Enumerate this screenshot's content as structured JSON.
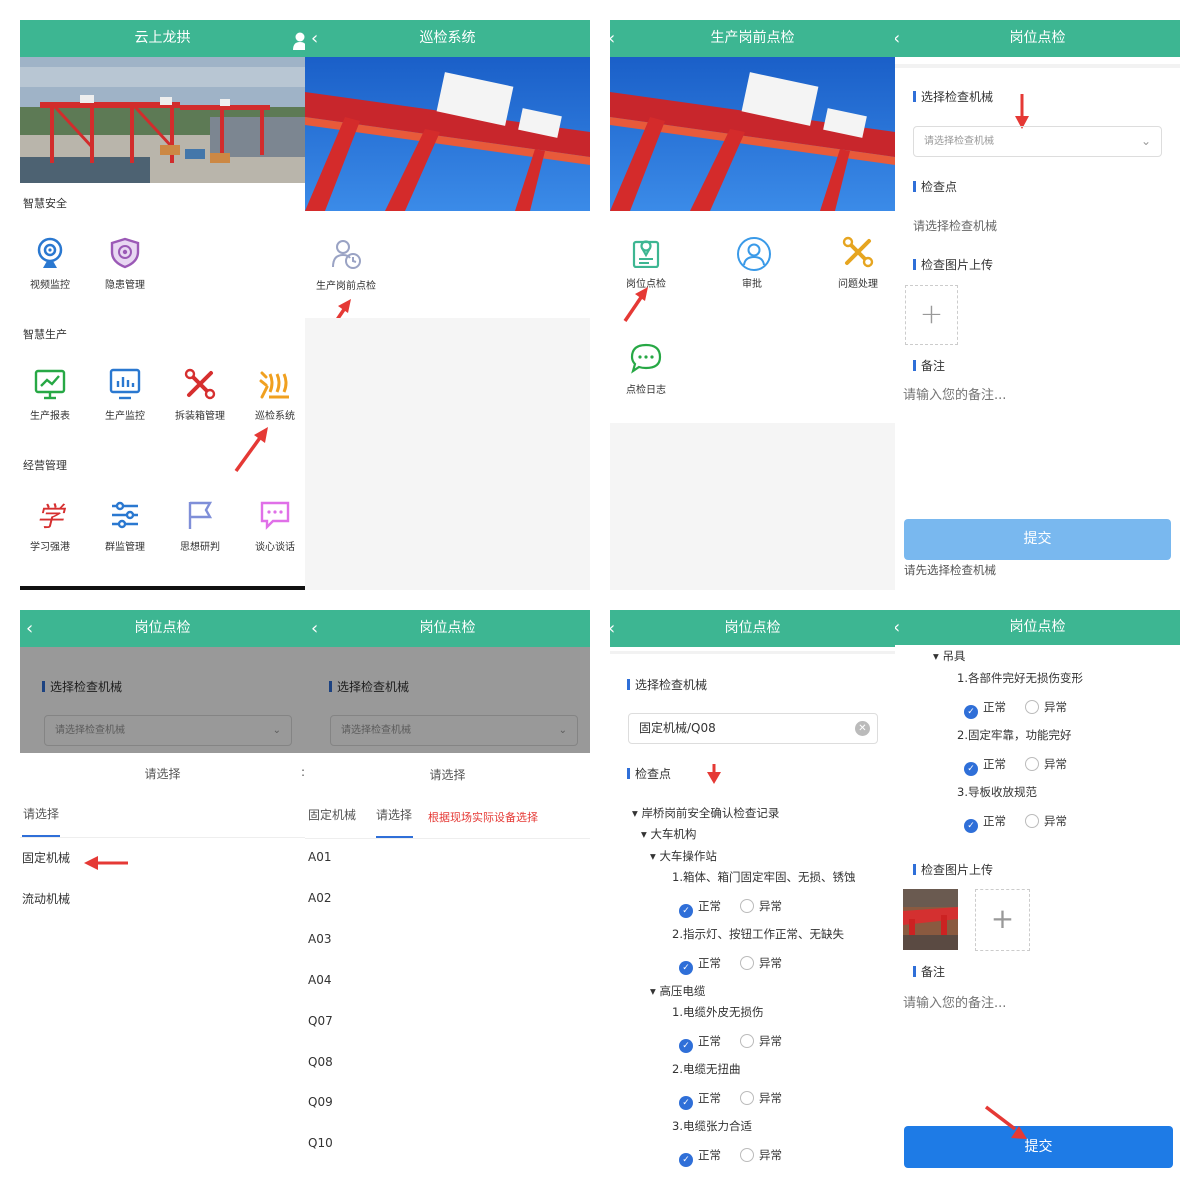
{
  "p1": {
    "title": "云上龙拱",
    "sections": [
      "智慧安全",
      "智慧生产",
      "经营管理"
    ],
    "safety": [
      "视频监控",
      "隐患管理"
    ],
    "production": [
      "生产报表",
      "生产监控",
      "拆装箱管理",
      "巡检系统"
    ],
    "management": [
      "学习强港",
      "群监管理",
      "思想研判",
      "谈心谈话"
    ]
  },
  "p2": {
    "title": "巡检系统",
    "item": "生产岗前点检"
  },
  "p3": {
    "title": "生产岗前点检",
    "items": [
      "岗位点检",
      "审批",
      "问题处理",
      "点检日志"
    ]
  },
  "p4": {
    "title": "岗位点检",
    "select_label": "选择检查机械",
    "select_placeholder": "请选择检查机械",
    "point_label": "检查点",
    "point_hint": "请选择检查机械",
    "photo_label": "检查图片上传",
    "remark_label": "备注",
    "remark_placeholder": "请输入您的备注...",
    "submit": "提交",
    "warning": "请先选择检查机械"
  },
  "p5": {
    "title": "岗位点检",
    "select_label": "选择检查机械",
    "select_placeholder": "请选择检查机械",
    "picker_title": "请选择",
    "tab": "请选择",
    "options": [
      "固定机械",
      "流动机械"
    ]
  },
  "p6": {
    "title": "岗位点检",
    "select_label": "选择检查机械",
    "select_placeholder": "请选择检查机械",
    "picker_title": "请选择",
    "tab1": "固定机械",
    "tab2": "请选择",
    "tip": "根据现场实际设备选择",
    "options": [
      "A01",
      "A02",
      "A03",
      "A04",
      "Q07",
      "Q08",
      "Q09",
      "Q10"
    ]
  },
  "p7": {
    "title": "岗位点检",
    "select_label": "选择检查机械",
    "select_value": "固定机械/Q08",
    "point_label": "检查点",
    "tree": [
      "岸桥岗前安全确认检查记录",
      "大车机构",
      "大车操作站",
      "1.箱体、箱门固定牢固、无损、锈蚀",
      "2.指示灯、按钮工作正常、无缺失",
      "高压电缆",
      "1.电缆外皮无损伤",
      "2.电缆无扭曲",
      "3.电缆张力合适"
    ],
    "normal": "正常",
    "abnormal": "异常"
  },
  "p8": {
    "title": "岗位点检",
    "tree": [
      "吊具",
      "1.各部件完好无损伤变形",
      "2.固定牢靠，功能完好",
      "3.导板收放规范"
    ],
    "normal": "正常",
    "abnormal": "异常",
    "photo_label": "检查图片上传",
    "remark_label": "备注",
    "remark_placeholder": "请输入您的备注...",
    "submit": "提交"
  },
  "colors": {
    "header": "#3db692",
    "accent": "#2f6fd8",
    "arrow": "#e53935",
    "submit_disabled": "#79b8ef",
    "submit": "#1e7be6"
  }
}
